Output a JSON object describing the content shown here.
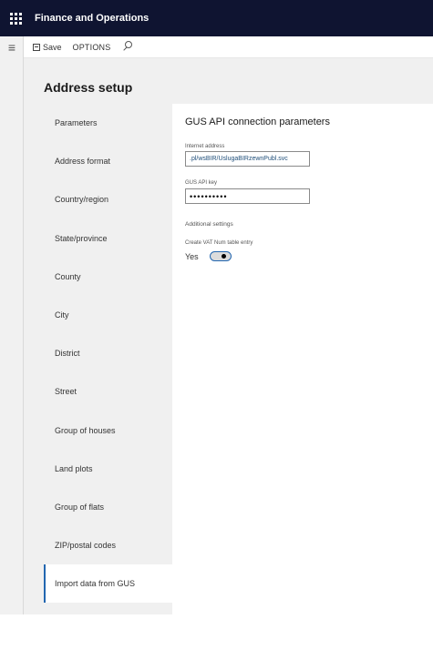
{
  "app": {
    "title": "Finance and Operations"
  },
  "toolbar": {
    "save_label": "Save",
    "options_label": "OPTIONS"
  },
  "page": {
    "title": "Address setup"
  },
  "nav": {
    "items": [
      {
        "label": "Parameters"
      },
      {
        "label": "Address format"
      },
      {
        "label": "Country/region"
      },
      {
        "label": "State/province"
      },
      {
        "label": "County"
      },
      {
        "label": "City"
      },
      {
        "label": "District"
      },
      {
        "label": "Street"
      },
      {
        "label": "Group of houses"
      },
      {
        "label": "Land plots"
      },
      {
        "label": "Group of flats"
      },
      {
        "label": "ZIP/postal codes"
      },
      {
        "label": "Import data from GUS"
      }
    ],
    "selected_index": 12
  },
  "panel": {
    "title": "GUS API connection parameters",
    "internet_address": {
      "label": "Internet address",
      "value": ".pl/wsBIR/UslugaBIRzewnPubl.svc"
    },
    "api_key": {
      "label": "GUS API key",
      "value": "••••••••••"
    },
    "additional_settings": "Additional settings",
    "vat_toggle": {
      "label": "Create VAT Num table entry",
      "value_text": "Yes",
      "on": true
    }
  },
  "colors": {
    "topbar": "#0f1431",
    "accent": "#2266b0"
  }
}
